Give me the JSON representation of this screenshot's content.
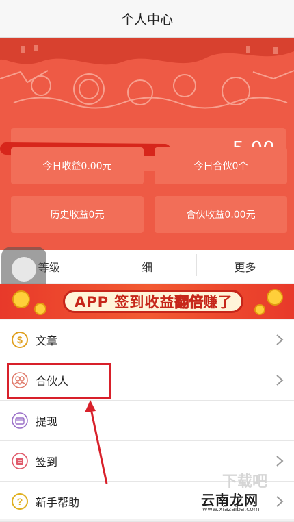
{
  "topbar": {
    "title": "个人中心"
  },
  "balance": {
    "amount": "5.00"
  },
  "stats": [
    {
      "label": "今日收益0.00元"
    },
    {
      "label": "今日合伙0个"
    },
    {
      "label": "历史收益0元"
    },
    {
      "label": "合伙收益0.00元"
    }
  ],
  "tabs": [
    {
      "label": "等级"
    },
    {
      "label": "细"
    },
    {
      "label": "更多"
    }
  ],
  "promo": {
    "prefix": "APP 签到收益",
    "highlight1": "翻",
    "highlight2": "倍",
    "suffix": "赚了"
  },
  "menu": [
    {
      "label": "文章",
      "icon": "dollar-icon",
      "chevron": true
    },
    {
      "label": "合伙人",
      "icon": "partner-icon",
      "chevron": true
    },
    {
      "label": "提现",
      "icon": "wallet-icon",
      "chevron": false
    },
    {
      "label": "签到",
      "icon": "checkin-icon",
      "chevron": true
    },
    {
      "label": "新手帮助",
      "icon": "help-icon",
      "chevron": true
    }
  ],
  "watermark": {
    "title": "云南龙网",
    "url": "www.xiazaiba.com",
    "logo": "下载吧"
  },
  "colors": {
    "header": "#ee5a45",
    "tile": "#f26e58",
    "highlight": "#d8202a"
  }
}
